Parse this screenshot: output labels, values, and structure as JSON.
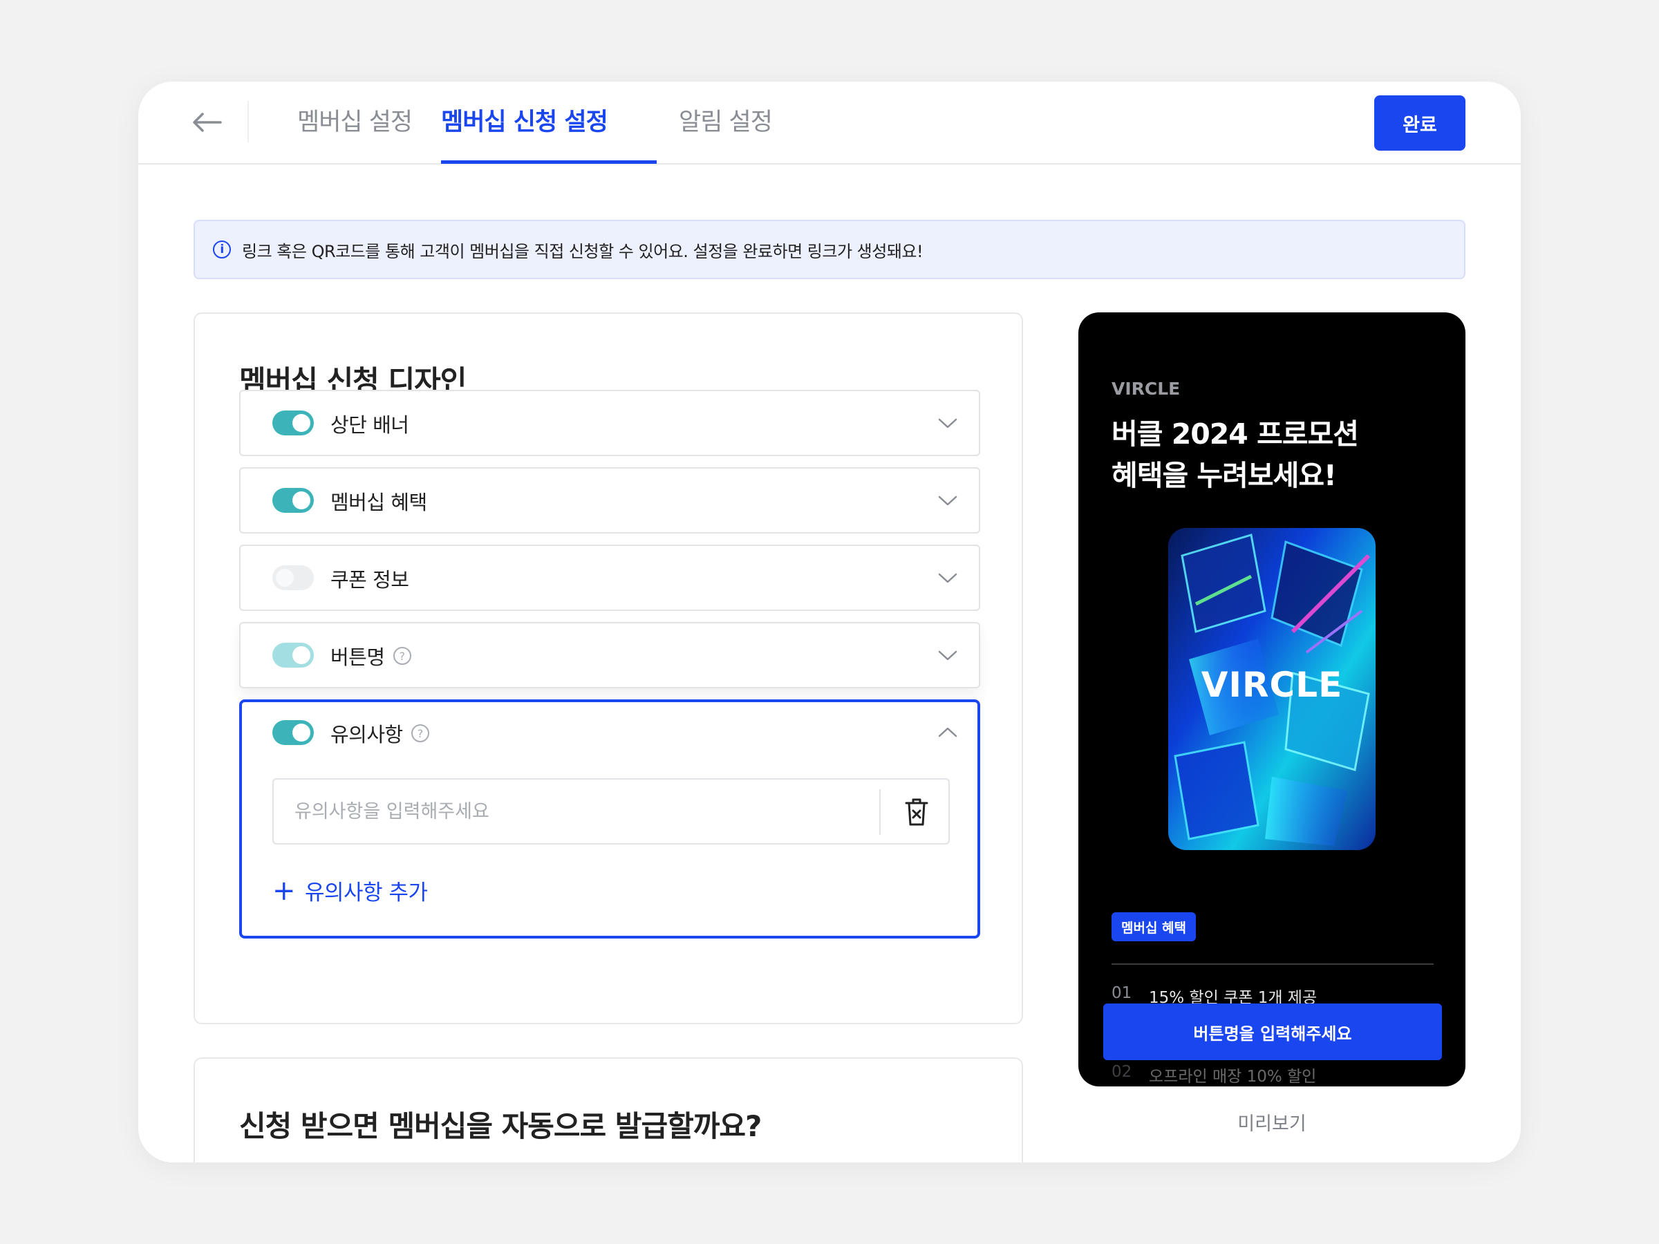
{
  "header": {
    "tabs": [
      {
        "label": "멤버십 설정",
        "active": false
      },
      {
        "label": "멤버십 신청 설정",
        "active": true
      },
      {
        "label": "알림 설정",
        "active": false
      }
    ],
    "done_label": "완료",
    "accent_color": "#1a46f0"
  },
  "info_banner": {
    "text": "링크 혹은 QR코드를 통해 고객이 멤버십을 직접 신청할 수 있어요. 설정을 완료하면 링크가 생성돼요!",
    "icon": "info-icon"
  },
  "design_card": {
    "title": "멤버십 신청 디자인",
    "sections": [
      {
        "label": "상단 배너",
        "enabled": true,
        "help": false
      },
      {
        "label": "멤버십 혜택",
        "enabled": true,
        "help": false
      },
      {
        "label": "쿠폰 정보",
        "enabled": false,
        "help": false
      },
      {
        "label": "버튼명",
        "enabled": true,
        "help": true
      },
      {
        "label": "유의사항",
        "enabled": true,
        "help": true,
        "expanded": true
      }
    ],
    "notice_placeholder": "유의사항을 입력해주세요",
    "add_notice_label": "유의사항 추가",
    "toggle_on_color": "#3cb3b9"
  },
  "auto_issue_card": {
    "title": "신청 받으면 멤버십을 자동으로 발급할까요?"
  },
  "preview": {
    "brand": "VIRCLE",
    "headline_line1": "버클 2024 프로모션",
    "headline_line2": "혜택을 누려보세요!",
    "hero_text": "VIRCLE",
    "benefit_badge": "멤버십 혜택",
    "benefits": [
      {
        "num": "01",
        "text": "15% 할인 쿠폰 1개 제공"
      },
      {
        "num": "02",
        "text": "오프라인 매장 10% 할인"
      }
    ],
    "cta_label": "버튼명을 입력해주세요",
    "label": "미리보기"
  }
}
